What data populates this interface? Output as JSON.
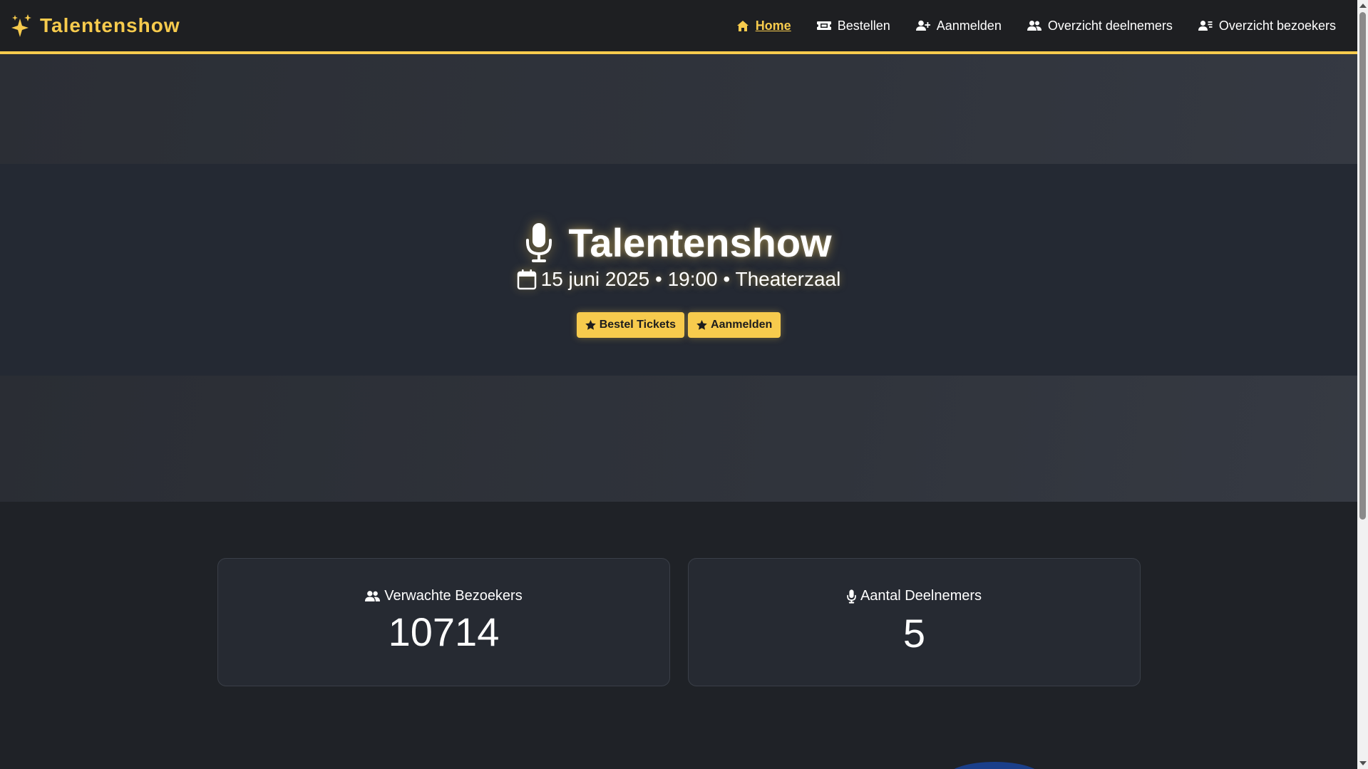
{
  "navbar": {
    "brand": "Talentenshow",
    "brand_icon": "sparkles-icon",
    "links": [
      {
        "label": "Home",
        "icon": "home-icon",
        "active": true
      },
      {
        "label": "Bestellen",
        "icon": "ticket-icon",
        "active": false
      },
      {
        "label": "Aanmelden",
        "icon": "user-plus-icon",
        "active": false
      },
      {
        "label": "Overzicht deelnemers",
        "icon": "users-icon",
        "active": false
      },
      {
        "label": "Overzicht bezoekers",
        "icon": "user-list-icon",
        "active": false
      }
    ]
  },
  "hero": {
    "title": "Talentenshow",
    "title_icon": "microphone-icon",
    "subtitle": "15 juni 2025 • 19:00 • Theaterzaal",
    "subtitle_icon": "calendar-icon",
    "buttons": [
      {
        "label": "Bestel Tickets",
        "icon": "star-icon"
      },
      {
        "label": "Aanmelden",
        "icon": "star-icon"
      }
    ]
  },
  "stats": [
    {
      "label": "Verwachte Bezoekers",
      "icon": "users-icon",
      "value": "10714"
    },
    {
      "label": "Aantal Deelnemers",
      "icon": "microphone-icon",
      "value": "5"
    }
  ],
  "colors": {
    "accent": "#f7cb4d",
    "navbar_bg": "#1e1f22",
    "page_bg": "#1f2227",
    "card_bg": "#262a32"
  }
}
